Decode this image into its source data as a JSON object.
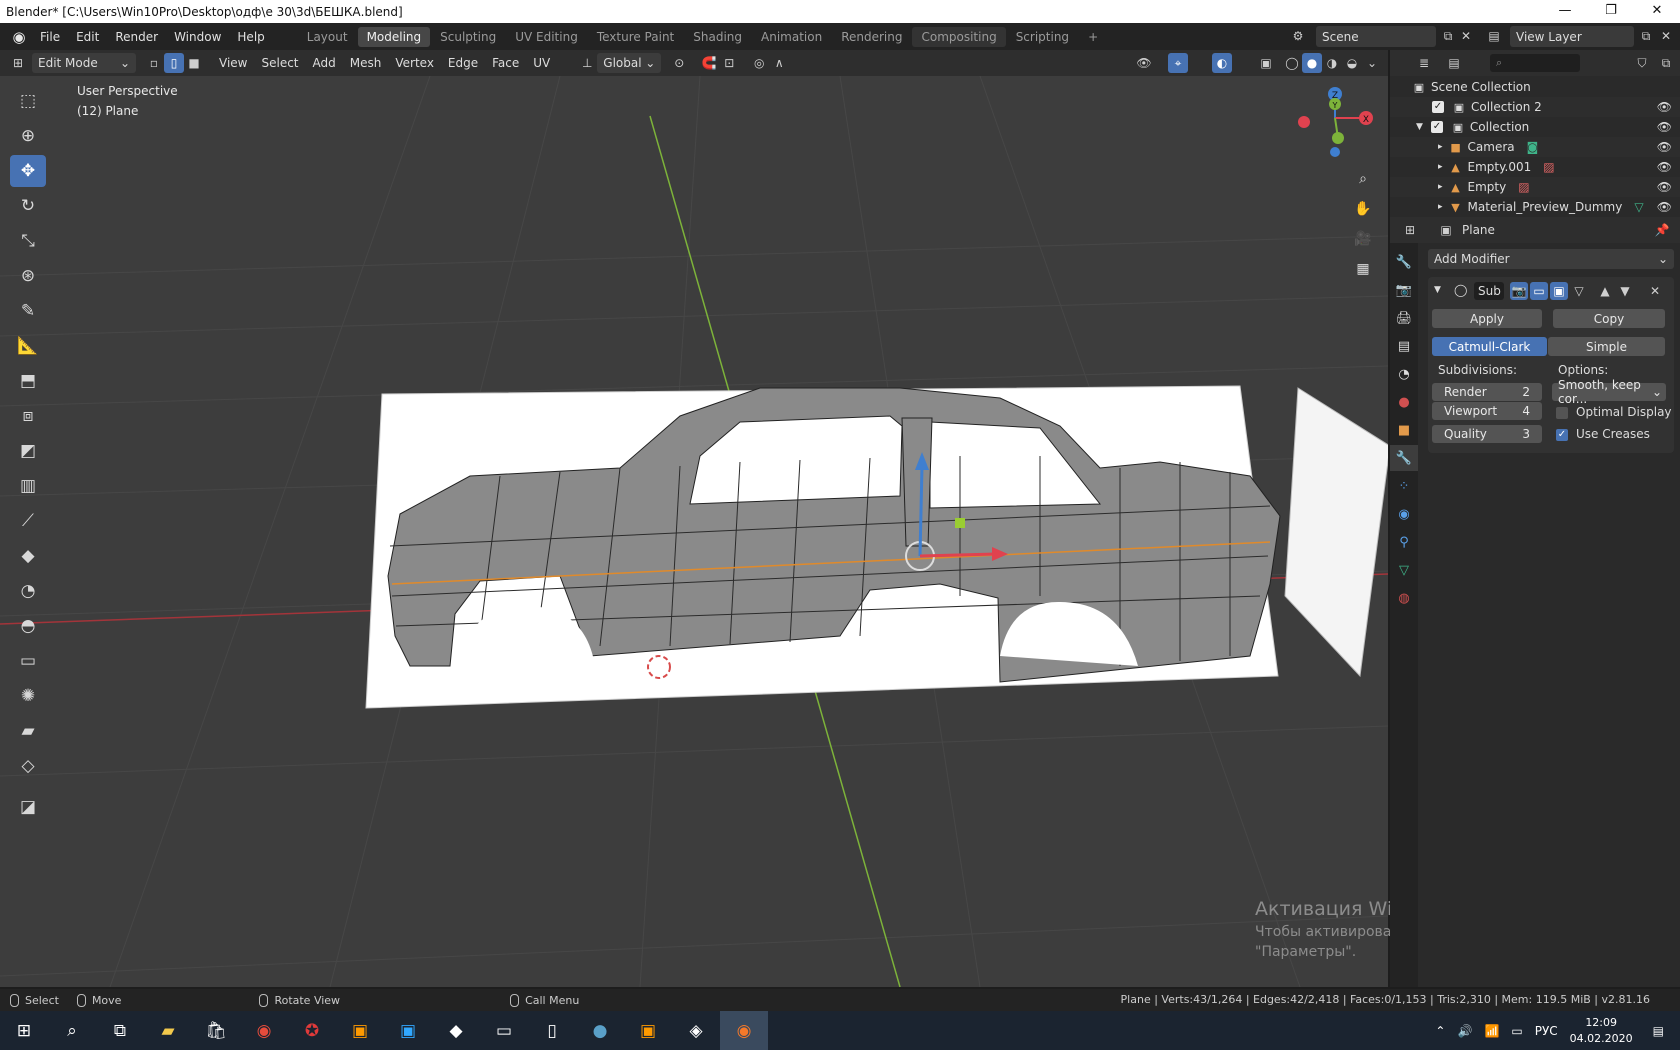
{
  "window": {
    "title": "Blender* [C:\\Users\\Win10Pro\\Desktop\\одф\\е 30\\3d\\БЕШКА.blend]",
    "min": "—",
    "max": "❐",
    "close": "✕"
  },
  "menu": {
    "items": [
      "File",
      "Edit",
      "Render",
      "Window",
      "Help"
    ],
    "workspaces": [
      "Layout",
      "Modeling",
      "Sculpting",
      "UV Editing",
      "Texture Paint",
      "Shading",
      "Animation",
      "Rendering",
      "Compositing",
      "Scripting"
    ],
    "active_workspace": "Modeling",
    "add_workspace": "+",
    "scene_label": "Scene",
    "view_layer_label": "View Layer"
  },
  "viewport_header": {
    "mode": "Edit Mode",
    "menus": [
      "View",
      "Select",
      "Add",
      "Mesh",
      "Vertex",
      "Edge",
      "Face",
      "UV"
    ],
    "orientation": "Global"
  },
  "viewport": {
    "perspective": "User Perspective",
    "object_label": "(12) Plane",
    "axis_labels": {
      "x": "X",
      "y": "Y",
      "z": "Z"
    }
  },
  "watermark": {
    "line1": "Активация Windows",
    "line2": "Чтобы активировать Windows, перейдите в раздел",
    "line3": "\"Параметры\"."
  },
  "outliner": {
    "root": "Scene Collection",
    "rows": [
      {
        "label": "Collection 2",
        "icon": "collection-icon"
      },
      {
        "label": "Collection",
        "icon": "collection-icon"
      },
      {
        "label": "Camera",
        "icon": "camera-icon"
      },
      {
        "label": "Empty.001",
        "icon": "empty-icon"
      },
      {
        "label": "Empty",
        "icon": "empty-icon"
      },
      {
        "label": "Material_Preview_Dummy",
        "icon": "mesh-icon"
      }
    ]
  },
  "properties": {
    "object_name": "Plane",
    "add_modifier": "Add Modifier",
    "modifier_name": "Sub",
    "apply": "Apply",
    "copy": "Copy",
    "catmull": "Catmull-Clark",
    "simple": "Simple",
    "subdivisions_label": "Subdivisions:",
    "options_label": "Options:",
    "render_label": "Render",
    "render_value": "2",
    "viewport_label": "Viewport",
    "viewport_value": "4",
    "quality_label": "Quality",
    "quality_value": "3",
    "uv_smooth": "Smooth, keep cor...",
    "optimal_display": "Optimal Display",
    "use_creases": "Use Creases"
  },
  "statusbar": {
    "select": "Select",
    "move": "Move",
    "rotate": "Rotate View",
    "call_menu": "Call Menu",
    "stats": "Plane | Verts:43/1,264 | Edges:42/2,418 | Faces:0/1,153 | Tris:2,310 | Mem: 119.5 MiB | v2.81.16"
  },
  "taskbar": {
    "lang": "РУС",
    "time": "12:09",
    "date": "04.02.2020"
  },
  "colors": {
    "accent": "#4772b3",
    "x_axis": "#e0424f",
    "y_axis": "#7db33a",
    "z_axis": "#3f7fd0"
  }
}
